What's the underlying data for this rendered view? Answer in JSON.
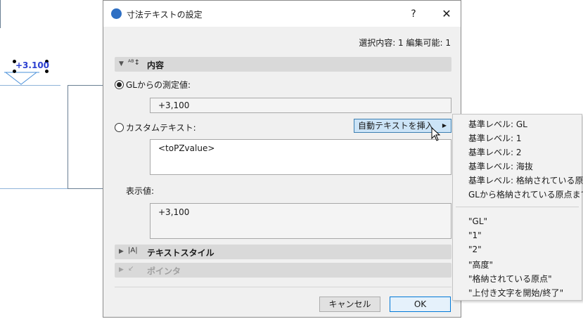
{
  "canvas": {
    "level_marker": "+3.100"
  },
  "dialog": {
    "title": "寸法テキストの設定",
    "help": "?",
    "close": "✕",
    "selection_info": "選択内容: 1 編集可能: 1",
    "sections": {
      "content": "内容",
      "text_style": "テキストスタイル",
      "pointer": "ポインタ"
    },
    "measured_label": "GLからの測定値:",
    "measured_value": "+3,100",
    "custom_label": "カスタムテキスト:",
    "insert_auto_text": "自動テキストを挿入",
    "custom_value": "<toPZvalue>",
    "display_label": "表示値:",
    "display_value": "+3,100",
    "cancel": "キャンセル",
    "ok": "OK"
  },
  "flyout": {
    "group1": [
      "基準レベル: GL",
      "基準レベル: 1",
      "基準レベル: 2",
      "基準レベル: 海抜",
      "基準レベル: 格納されている原点",
      "GLから格納されている原点まで"
    ],
    "group2": [
      "\"GL\"",
      "\"1\"",
      "\"2\"",
      "\"高度\"",
      "\"格納されている原点\"",
      "\"上付き文字を開始/終了\""
    ]
  }
}
